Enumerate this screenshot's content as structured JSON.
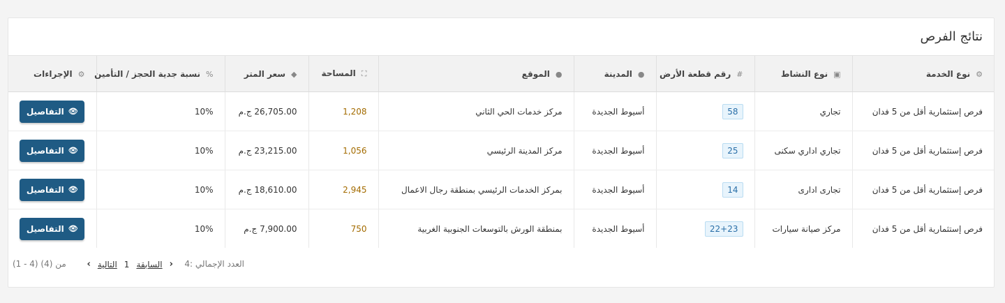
{
  "card": {
    "title": "نتائج الفرص"
  },
  "columns": [
    {
      "label": "نوع الخدمة",
      "icon": "cogs-icon",
      "glyph": "⚙"
    },
    {
      "label": "نوع النشاط",
      "icon": "briefcase-icon",
      "glyph": "▣"
    },
    {
      "label": "رقم قطعة الأرض",
      "icon": "hash-icon",
      "glyph": "#"
    },
    {
      "label": "المدينة",
      "icon": "map-marker-icon",
      "glyph": "●"
    },
    {
      "label": "الموقع",
      "icon": "map-marker-icon",
      "glyph": "●"
    },
    {
      "label": "المساحة",
      "icon": "expand-icon",
      "glyph": "⛶"
    },
    {
      "label": "سعر المتر",
      "icon": "tag-icon",
      "glyph": "◆"
    },
    {
      "label": "نسبة جدية الحجز / التأمين",
      "icon": "percent-icon",
      "glyph": "%"
    },
    {
      "label": "الإجراءات",
      "icon": "cogs-icon",
      "glyph": "⚙"
    }
  ],
  "rows": [
    {
      "service": "فرص إستثمارية أقل من 5 فدان",
      "activity": "تجاري",
      "plot": "58",
      "city": "أسيوط الجديدة",
      "location": "مركز خدمات الحي الثاني",
      "area": "1,208",
      "price": "26,705.00 ج.م",
      "percent": "10%",
      "action": "التفاصيل"
    },
    {
      "service": "فرص إستثمارية أقل من 5 فدان",
      "activity": "تجاري اداري سكنى",
      "plot": "25",
      "city": "أسيوط الجديدة",
      "location": "مركز المدينة الرئيسي",
      "area": "1,056",
      "price": "23,215.00 ج.م",
      "percent": "10%",
      "action": "التفاصيل"
    },
    {
      "service": "فرص إستثمارية أقل من 5 فدان",
      "activity": "تجارى ادارى",
      "plot": "14",
      "city": "أسيوط الجديدة",
      "location": "بمركز الخدمات الرئيسي بمنطقة رجال الاعمال",
      "area": "2,945",
      "price": "18,610.00 ج.م",
      "percent": "10%",
      "action": "التفاصيل"
    },
    {
      "service": "فرص إستثمارية أقل من 5 فدان",
      "activity": "مركز صيانة سيارات",
      "plot": "22+23",
      "city": "أسيوط الجديدة",
      "location": "بمنطقة الورش بالتوسعات الجنوبية الغربية",
      "area": "750",
      "price": "7,900.00 ج.م",
      "percent": "10%",
      "action": "التفاصيل"
    }
  ],
  "footer": {
    "total": "العدد الإجمالي :4",
    "prev": "السابقة",
    "page": "1",
    "next": "التالية",
    "range": "(1 - 4) من (4)"
  },
  "colors": {
    "button": "#1f5b84",
    "area_text": "#a36b00",
    "badge_bg": "#e8f4fc"
  }
}
